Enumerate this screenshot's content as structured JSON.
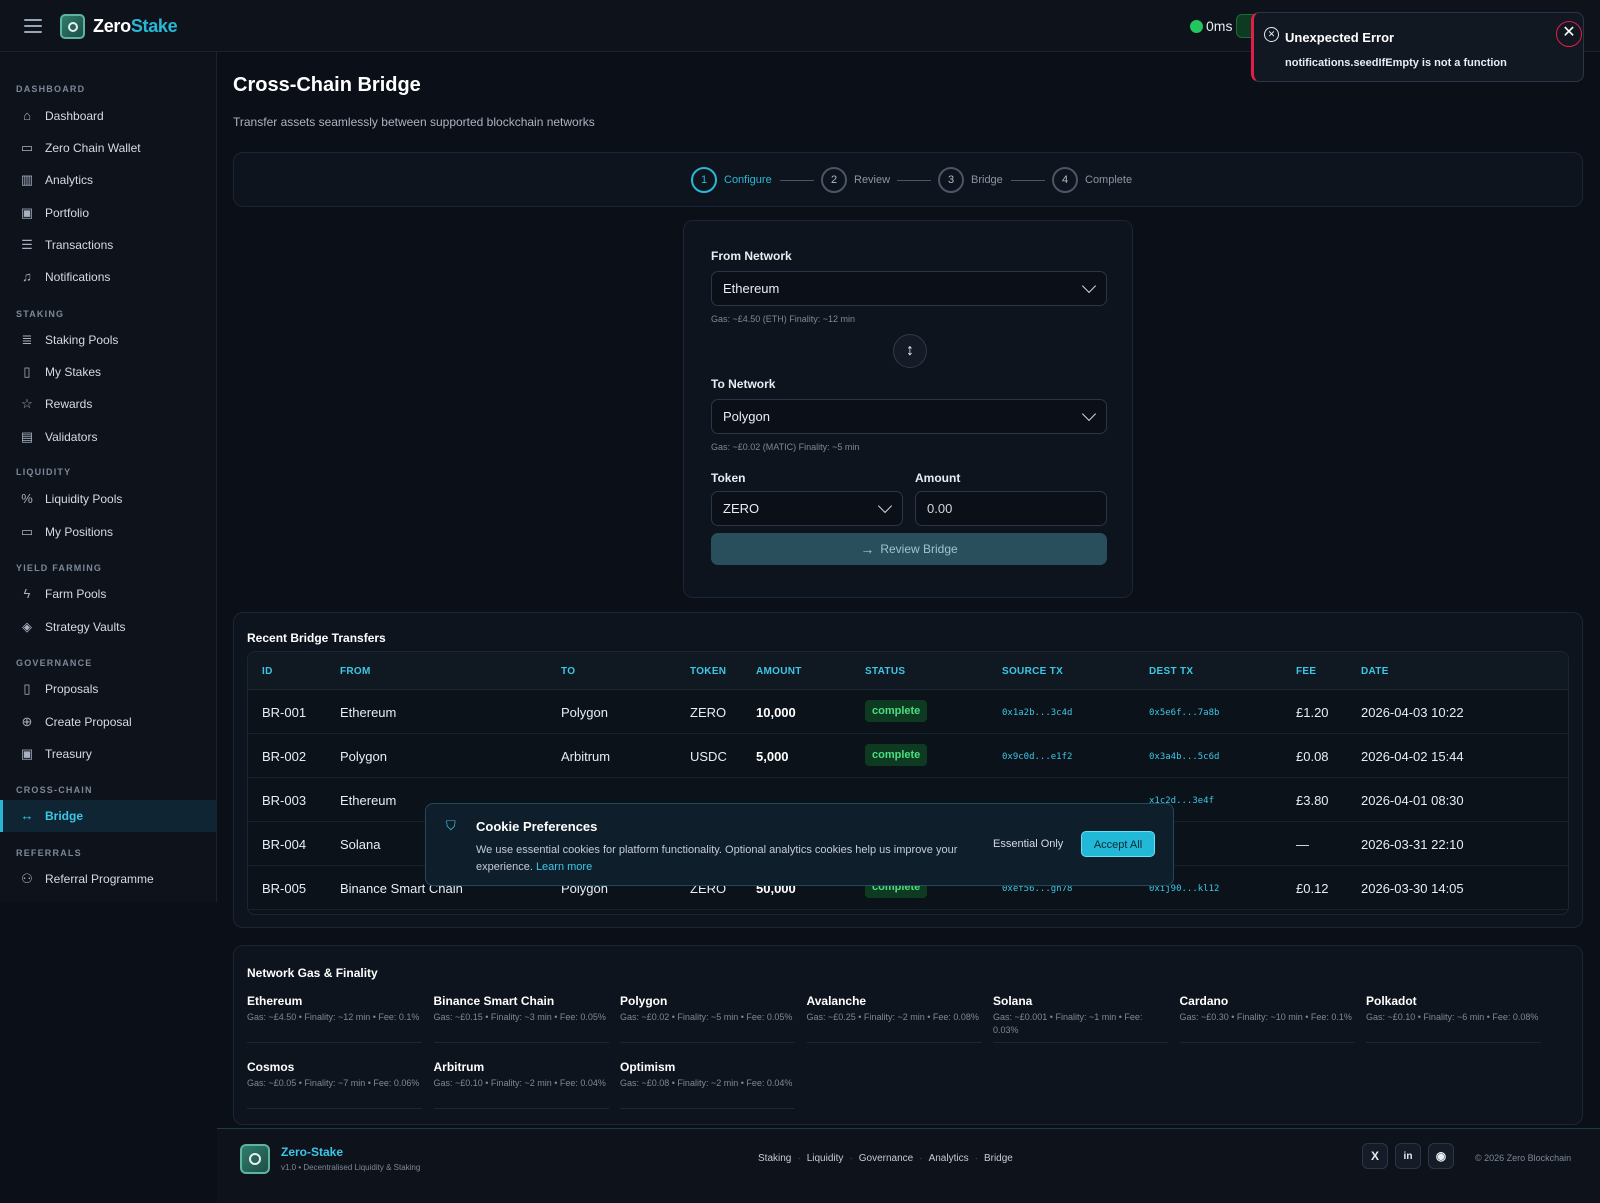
{
  "header": {
    "brand_main": "Zero",
    "brand_accent": "Stake",
    "latency": "0ms"
  },
  "sidebar": {
    "sections": [
      {
        "title": "DASHBOARD",
        "items": [
          {
            "label": "Dashboard",
            "icon": "home-icon"
          },
          {
            "label": "Zero Chain Wallet",
            "icon": "wallet-icon"
          },
          {
            "label": "Analytics",
            "icon": "chart-icon"
          },
          {
            "label": "Portfolio",
            "icon": "briefcase-icon"
          },
          {
            "label": "Transactions",
            "icon": "list-icon"
          },
          {
            "label": "Notifications",
            "icon": "bell-icon"
          }
        ]
      },
      {
        "title": "STAKING",
        "items": [
          {
            "label": "Staking Pools",
            "icon": "database-icon"
          },
          {
            "label": "My Stakes",
            "icon": "bookmark-icon"
          },
          {
            "label": "Rewards",
            "icon": "star-icon"
          },
          {
            "label": "Validators",
            "icon": "server-icon"
          }
        ]
      },
      {
        "title": "LIQUIDITY",
        "items": [
          {
            "label": "Liquidity Pools",
            "icon": "percent-icon"
          },
          {
            "label": "My Positions",
            "icon": "wallet-icon"
          }
        ]
      },
      {
        "title": "YIELD FARMING",
        "items": [
          {
            "label": "Farm Pools",
            "icon": "bolt-icon"
          },
          {
            "label": "Strategy Vaults",
            "icon": "cube-icon"
          }
        ]
      },
      {
        "title": "GOVERNANCE",
        "items": [
          {
            "label": "Proposals",
            "icon": "file-icon"
          },
          {
            "label": "Create Proposal",
            "icon": "plus-circle-icon"
          },
          {
            "label": "Treasury",
            "icon": "treasury-icon"
          }
        ]
      },
      {
        "title": "CROSS-CHAIN",
        "items": [
          {
            "label": "Bridge",
            "icon": "arrows-horizontal-icon",
            "active": true
          }
        ]
      },
      {
        "title": "REFERRALS",
        "items": [
          {
            "label": "Referral Programme",
            "icon": "users-icon"
          }
        ]
      }
    ]
  },
  "page": {
    "title": "Cross-Chain Bridge",
    "subtitle": "Transfer assets seamlessly between supported blockchain networks"
  },
  "steps": [
    {
      "num": "1",
      "label": "Configure"
    },
    {
      "num": "2",
      "label": "Review"
    },
    {
      "num": "3",
      "label": "Bridge"
    },
    {
      "num": "4",
      "label": "Complete"
    }
  ],
  "form": {
    "from_label": "From Network",
    "from_value": "Ethereum",
    "from_hint": "Gas: ~£4.50 (ETH)   Finality: ~12 min",
    "to_label": "To Network",
    "to_value": "Polygon",
    "to_hint": "Gas: ~£0.02 (MATIC)   Finality: ~5 min",
    "token_label": "Token",
    "token_value": "ZERO",
    "amount_label": "Amount",
    "amount_placeholder": "0.00",
    "review_button": "Review Bridge"
  },
  "transfers": {
    "title": "Recent Bridge Transfers",
    "columns": [
      "ID",
      "FROM",
      "TO",
      "TOKEN",
      "AMOUNT",
      "STATUS",
      "SOURCE TX",
      "DEST TX",
      "FEE",
      "DATE"
    ],
    "rows": [
      {
        "id": "BR-001",
        "from": "Ethereum",
        "to": "Polygon",
        "token": "ZERO",
        "amount": "10,000",
        "status": "complete",
        "source_tx": "0x1a2b...3c4d",
        "dest_tx": "0x5e6f...7a8b",
        "fee": "£1.20",
        "date": "2026-04-03 10:22"
      },
      {
        "id": "BR-002",
        "from": "Polygon",
        "to": "Arbitrum",
        "token": "USDC",
        "amount": "5,000",
        "status": "complete",
        "source_tx": "0x9c0d...e1f2",
        "dest_tx": "0x3a4b...5c6d",
        "fee": "£0.08",
        "date": "2026-04-02 15:44"
      },
      {
        "id": "BR-003",
        "from": "Ethereum",
        "to": "",
        "token": "",
        "amount": "",
        "status": "",
        "source_tx": "",
        "dest_tx": "x1c2d...3e4f",
        "fee": "£3.80",
        "date": "2026-04-01 08:30"
      },
      {
        "id": "BR-004",
        "from": "Solana",
        "to": "",
        "token": "",
        "amount": "",
        "status": "",
        "source_tx": "",
        "dest_tx": "",
        "fee": "—",
        "date": "2026-03-31 22:10"
      },
      {
        "id": "BR-005",
        "from": "Binance Smart Chain",
        "to": "Polygon",
        "token": "ZERO",
        "amount": "50,000",
        "status": "complete",
        "source_tx": "0xef56...gh78",
        "dest_tx": "0xij90...kl12",
        "fee": "£0.12",
        "date": "2026-03-30 14:05"
      }
    ]
  },
  "gas": {
    "title": "Network Gas & Finality",
    "networks": [
      {
        "name": "Ethereum",
        "detail": "Gas: ~£4.50 • Finality: ~12 min • Fee: 0.1%"
      },
      {
        "name": "Binance Smart Chain",
        "detail": "Gas: ~£0.15 • Finality: ~3 min • Fee: 0.05%"
      },
      {
        "name": "Polygon",
        "detail": "Gas: ~£0.02 • Finality: ~5 min • Fee: 0.05%"
      },
      {
        "name": "Avalanche",
        "detail": "Gas: ~£0.25 • Finality: ~2 min • Fee: 0.08%"
      },
      {
        "name": "Solana",
        "detail": "Gas: ~£0.001 • Finality: ~1 min • Fee: 0.03%"
      },
      {
        "name": "Cardano",
        "detail": "Gas: ~£0.30 • Finality: ~10 min • Fee: 0.1%"
      },
      {
        "name": "Polkadot",
        "detail": "Gas: ~£0.10 • Finality: ~6 min • Fee: 0.08%"
      },
      {
        "name": "Cosmos",
        "detail": "Gas: ~£0.05 • Finality: ~7 min • Fee: 0.06%"
      },
      {
        "name": "Arbitrum",
        "detail": "Gas: ~£0.10 • Finality: ~2 min • Fee: 0.04%"
      },
      {
        "name": "Optimism",
        "detail": "Gas: ~£0.08 • Finality: ~2 min • Fee: 0.04%"
      }
    ]
  },
  "footer": {
    "name": "Zero-Stake",
    "version": "v1.0 • Decentralised Liquidity & Staking",
    "links": [
      "Staking",
      "Liquidity",
      "Governance",
      "Analytics",
      "Bridge"
    ],
    "social": [
      {
        "label": "X",
        "icon": "x-icon"
      },
      {
        "label": "in",
        "icon": "linkedin-icon"
      },
      {
        "label": "◉",
        "icon": "github-icon"
      }
    ],
    "copyright": "© 2026 Zero Blockchain"
  },
  "toast": {
    "title": "Unexpected Error",
    "message": "notifications.seedIfEmpty is not a function",
    "close": "✕"
  },
  "cookie": {
    "title": "Cookie Preferences",
    "text": "We use essential cookies for platform functionality. Optional analytics cookies help us improve your experience.",
    "learn_more": "Learn more",
    "essential_button": "Essential Only",
    "accept_button": "Accept All"
  },
  "colors": {
    "accent": "#28b8d6",
    "success": "#4ade80",
    "error": "#e11d48"
  }
}
